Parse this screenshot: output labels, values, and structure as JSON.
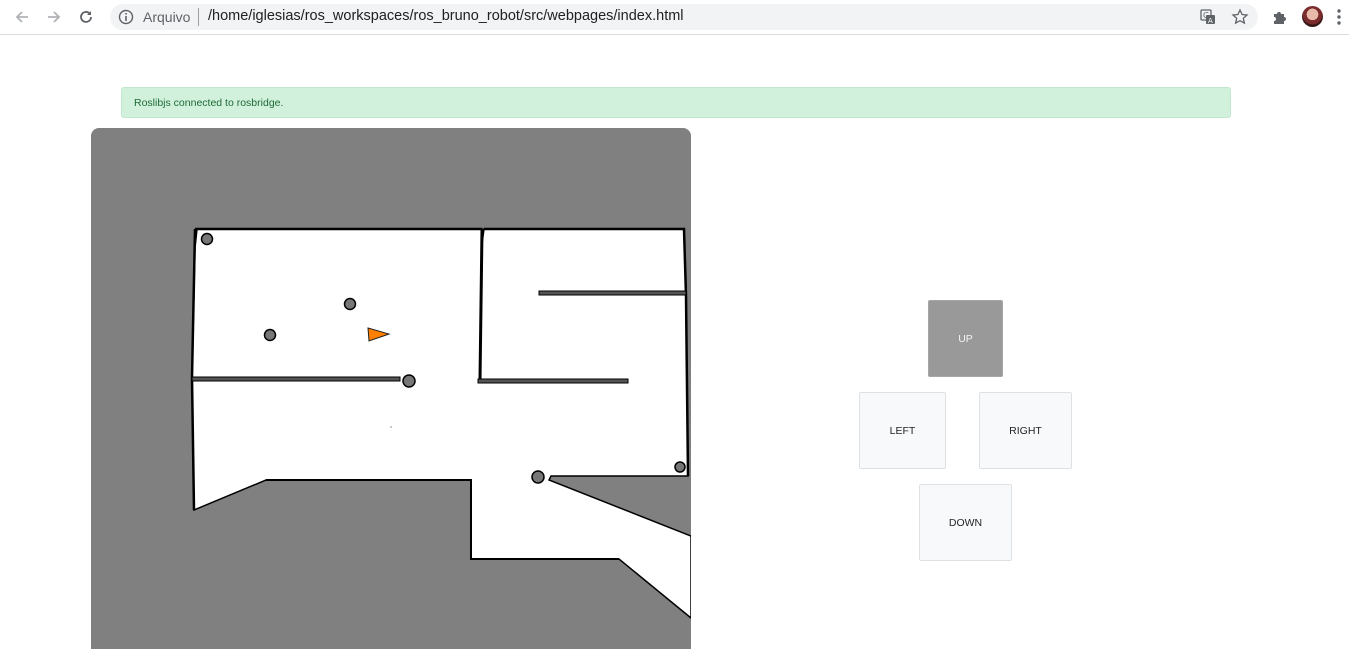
{
  "browser": {
    "scheme_label": "Arquivo",
    "url": "/home/iglesias/ros_workspaces/ros_bruno_robot/src/webpages/index.html",
    "icons": [
      "back-arrow-icon",
      "forward-arrow-icon",
      "reload-icon",
      "info-icon",
      "translate-icon",
      "star-icon",
      "puzzle-extensions-icon",
      "profile-avatar",
      "kebab-menu-icon"
    ]
  },
  "status": {
    "message": "Roslibjs connected to rosbridge.",
    "color": "#d1f1dc"
  },
  "map": {
    "unknown_color": "#808080",
    "free_color": "#ffffff",
    "robot_color": "#ff7f00"
  },
  "controls": {
    "up": "UP",
    "left": "LEFT",
    "right": "RIGHT",
    "down": "DOWN",
    "active": "up"
  }
}
